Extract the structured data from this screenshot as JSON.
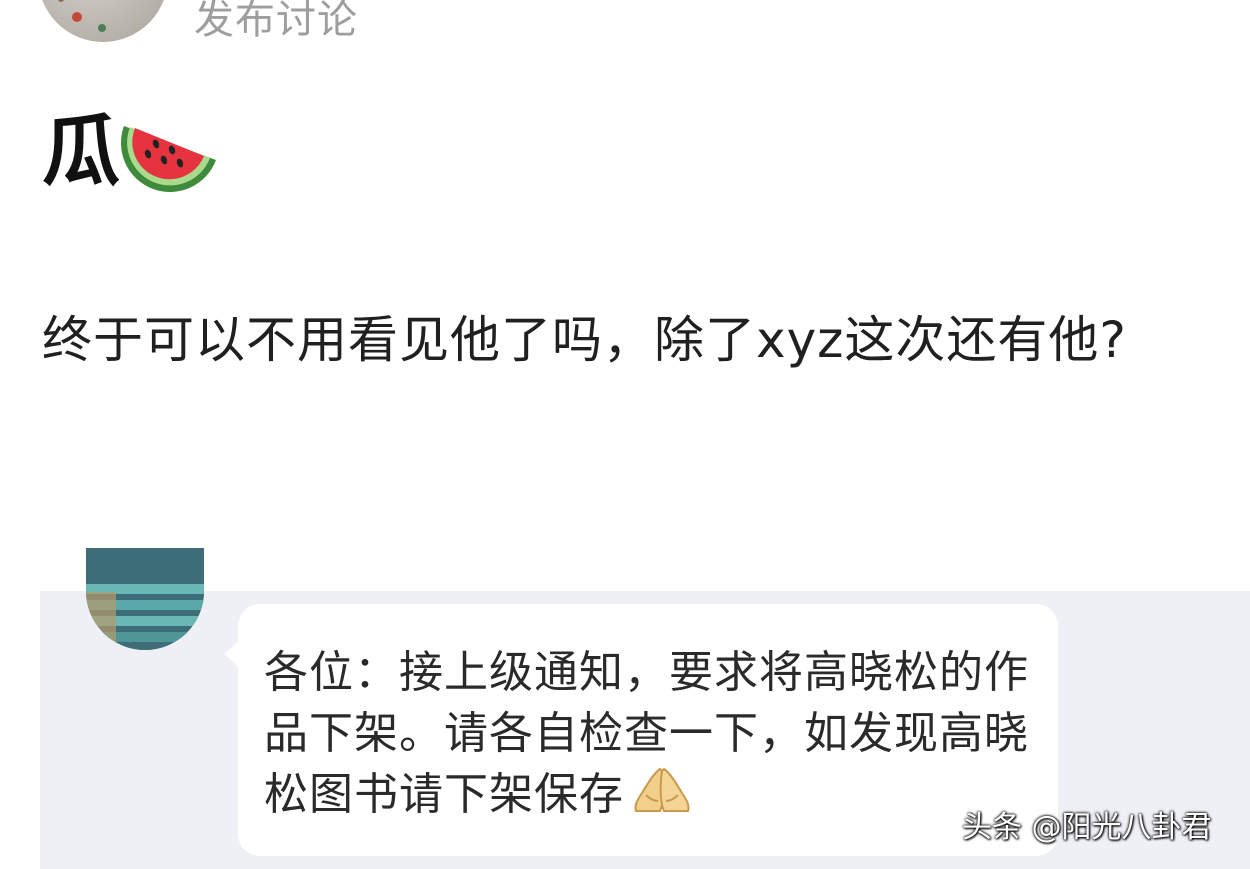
{
  "header": {
    "title": "发布讨论"
  },
  "post": {
    "title": "瓜",
    "title_emoji": "watermelon",
    "body": "终于可以不用看见他了吗，除了xyz这次还有他?"
  },
  "embedded_chat": {
    "message": "各位：接上级通知，要求将高晓松的作品下架。请各自检查一下，如发现高晓松图书请下架保存",
    "message_emoji": "folded-hands"
  },
  "watermark": {
    "text": "头条 @阳光八卦君"
  },
  "colors": {
    "header_text": "#9e9e9e",
    "embedded_background": "#eef0f6",
    "bubble_background": "#ffffff",
    "watermelon_red": "#e5343f",
    "watermelon_rind": "#3f8a3d"
  }
}
